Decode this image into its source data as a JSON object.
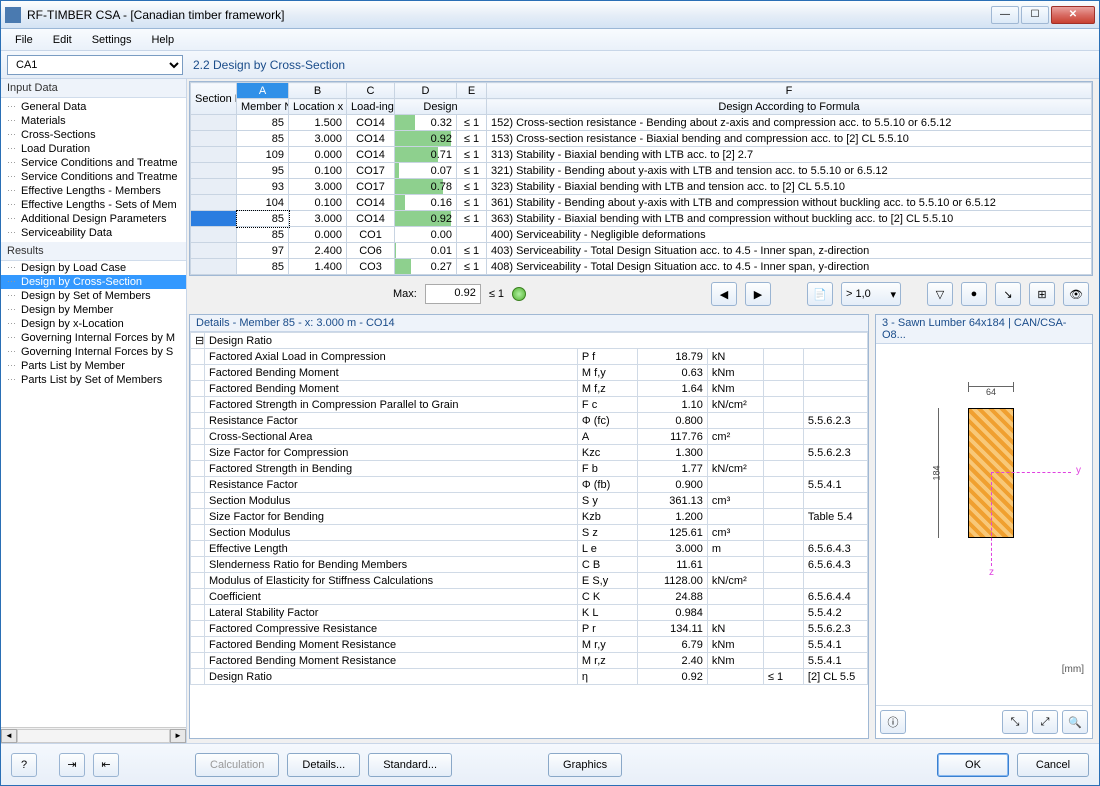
{
  "window": {
    "title": "RF-TIMBER CSA - [Canadian timber framework]"
  },
  "menu": {
    "file": "File",
    "edit": "Edit",
    "settings": "Settings",
    "help": "Help"
  },
  "case_selector": "CA1",
  "section_heading": "2.2  Design by Cross-Section",
  "sidebar": {
    "group1": "Input Data",
    "items1": [
      "General Data",
      "Materials",
      "Cross-Sections",
      "Load Duration",
      "Service Conditions and Treatme",
      "Service Conditions and Treatme",
      "Effective Lengths - Members",
      "Effective Lengths - Sets of Mem",
      "Additional Design Parameters",
      "Serviceability Data"
    ],
    "group2": "Results",
    "items2": [
      "Design by Load Case",
      "Design by Cross-Section",
      "Design by Set of Members",
      "Design by Member",
      "Design by x-Location",
      "Governing Internal Forces by M",
      "Governing Internal Forces by S",
      "Parts List by Member",
      "Parts List by Set of Members"
    ],
    "selected": 1
  },
  "grid": {
    "colhead_letters": [
      "A",
      "B",
      "C",
      "D",
      "E",
      "F"
    ],
    "headers": {
      "section": "Section No.",
      "member": "Member No.",
      "location": "Location x [m]",
      "loading": "Load-ing",
      "design": "Design",
      "formula": "Design According to Formula"
    },
    "rows": [
      {
        "m": "85",
        "x": "1.500",
        "lc": "CO14",
        "d": "0.32",
        "cmp": "≤ 1",
        "desc": "152) Cross-section resistance - Bending about z-axis and compression acc. to 5.5.10 or 6.5.12"
      },
      {
        "m": "85",
        "x": "3.000",
        "lc": "CO14",
        "d": "0.92",
        "cmp": "≤ 1",
        "desc": "153) Cross-section resistance - Biaxial bending and compression acc. to [2] CL 5.5.10"
      },
      {
        "m": "109",
        "x": "0.000",
        "lc": "CO14",
        "d": "0.71",
        "cmp": "≤ 1",
        "desc": "313) Stability - Biaxial bending with LTB acc. to [2] 2.7"
      },
      {
        "m": "95",
        "x": "0.100",
        "lc": "CO17",
        "d": "0.07",
        "cmp": "≤ 1",
        "desc": "321) Stability - Bending about y-axis with LTB and tension acc. to 5.5.10 or 6.5.12"
      },
      {
        "m": "93",
        "x": "3.000",
        "lc": "CO17",
        "d": "0.78",
        "cmp": "≤ 1",
        "desc": "323) Stability - Biaxial bending with LTB and tension acc. to [2] CL 5.5.10"
      },
      {
        "m": "104",
        "x": "0.100",
        "lc": "CO14",
        "d": "0.16",
        "cmp": "≤ 1",
        "desc": "361) Stability - Bending about y-axis with LTB and compression without buckling acc. to 5.5.10 or 6.5.12"
      },
      {
        "m": "85",
        "x": "3.000",
        "lc": "CO14",
        "d": "0.92",
        "cmp": "≤ 1",
        "desc": "363) Stability - Biaxial bending with LTB and compression without buckling acc. to [2] CL 5.5.10",
        "sel": true
      },
      {
        "m": "85",
        "x": "0.000",
        "lc": "CO1",
        "d": "0.00",
        "cmp": "",
        "desc": "400) Serviceability - Negligible deformations"
      },
      {
        "m": "97",
        "x": "2.400",
        "lc": "CO6",
        "d": "0.01",
        "cmp": "≤ 1",
        "desc": "403) Serviceability - Total Design Situation acc. to 4.5 - Inner span, z-direction"
      },
      {
        "m": "85",
        "x": "1.400",
        "lc": "CO3",
        "d": "0.27",
        "cmp": "≤ 1",
        "desc": "408) Serviceability - Total Design Situation acc. to 4.5 - Inner span, y-direction"
      }
    ],
    "max_label": "Max:",
    "max_val": "0.92",
    "max_cmp": "≤ 1"
  },
  "filter_combo": "> 1,0",
  "details": {
    "title": "Details - Member 85 - x: 3.000 m - CO14",
    "section_head": "Design Ratio",
    "rows": [
      {
        "n": "Factored Axial Load in Compression",
        "s": "P f",
        "v": "18.79",
        "u": "kN",
        "r": ""
      },
      {
        "n": "Factored Bending Moment",
        "s": "M f,y",
        "v": "0.63",
        "u": "kNm",
        "r": ""
      },
      {
        "n": "Factored Bending Moment",
        "s": "M f,z",
        "v": "1.64",
        "u": "kNm",
        "r": ""
      },
      {
        "n": "Factored Strength in Compression Parallel to Grain",
        "s": "F c",
        "v": "1.10",
        "u": "kN/cm²",
        "r": ""
      },
      {
        "n": "Resistance Factor",
        "s": "Φ (fc)",
        "v": "0.800",
        "u": "",
        "r": "5.5.6.2.3"
      },
      {
        "n": "Cross-Sectional Area",
        "s": "A",
        "v": "117.76",
        "u": "cm²",
        "r": ""
      },
      {
        "n": "Size Factor for Compression",
        "s": "Kzc",
        "v": "1.300",
        "u": "",
        "r": "5.5.6.2.3"
      },
      {
        "n": "Factored Strength in Bending",
        "s": "F b",
        "v": "1.77",
        "u": "kN/cm²",
        "r": ""
      },
      {
        "n": "Resistance Factor",
        "s": "Φ (fb)",
        "v": "0.900",
        "u": "",
        "r": "5.5.4.1"
      },
      {
        "n": "Section Modulus",
        "s": "S y",
        "v": "361.13",
        "u": "cm³",
        "r": ""
      },
      {
        "n": "Size Factor for Bending",
        "s": "Kzb",
        "v": "1.200",
        "u": "",
        "r": "Table 5.4"
      },
      {
        "n": "Section Modulus",
        "s": "S z",
        "v": "125.61",
        "u": "cm³",
        "r": ""
      },
      {
        "n": "Effective Length",
        "s": "L e",
        "v": "3.000",
        "u": "m",
        "r": "6.5.6.4.3"
      },
      {
        "n": "Slenderness Ratio for Bending Members",
        "s": "C B",
        "v": "11.61",
        "u": "",
        "r": "6.5.6.4.3"
      },
      {
        "n": "Modulus of Elasticity for Stiffness Calculations",
        "s": "E S,y",
        "v": "1128.00",
        "u": "kN/cm²",
        "r": ""
      },
      {
        "n": "Coefficient",
        "s": "C K",
        "v": "24.88",
        "u": "",
        "r": "6.5.6.4.4"
      },
      {
        "n": "Lateral Stability Factor",
        "s": "K L",
        "v": "0.984",
        "u": "",
        "r": "5.5.4.2"
      },
      {
        "n": "Factored Compressive Resistance",
        "s": "P r",
        "v": "134.11",
        "u": "kN",
        "r": "5.5.6.2.3"
      },
      {
        "n": "Factored Bending Moment Resistance",
        "s": "M r,y",
        "v": "6.79",
        "u": "kNm",
        "r": "5.5.4.1"
      },
      {
        "n": "Factored Bending Moment Resistance",
        "s": "M r,z",
        "v": "2.40",
        "u": "kNm",
        "r": "5.5.4.1"
      },
      {
        "n": "Design Ratio",
        "s": "η",
        "v": "0.92",
        "u": "",
        "c": "≤ 1",
        "r": "[2] CL 5.5"
      }
    ]
  },
  "preview": {
    "title": "3 - Sawn Lumber 64x184 | CAN/CSA-O8...",
    "width": "64",
    "height": "184",
    "unit": "[mm]"
  },
  "buttons": {
    "calc": "Calculation",
    "details": "Details...",
    "standard": "Standard...",
    "graphics": "Graphics",
    "ok": "OK",
    "cancel": "Cancel"
  }
}
